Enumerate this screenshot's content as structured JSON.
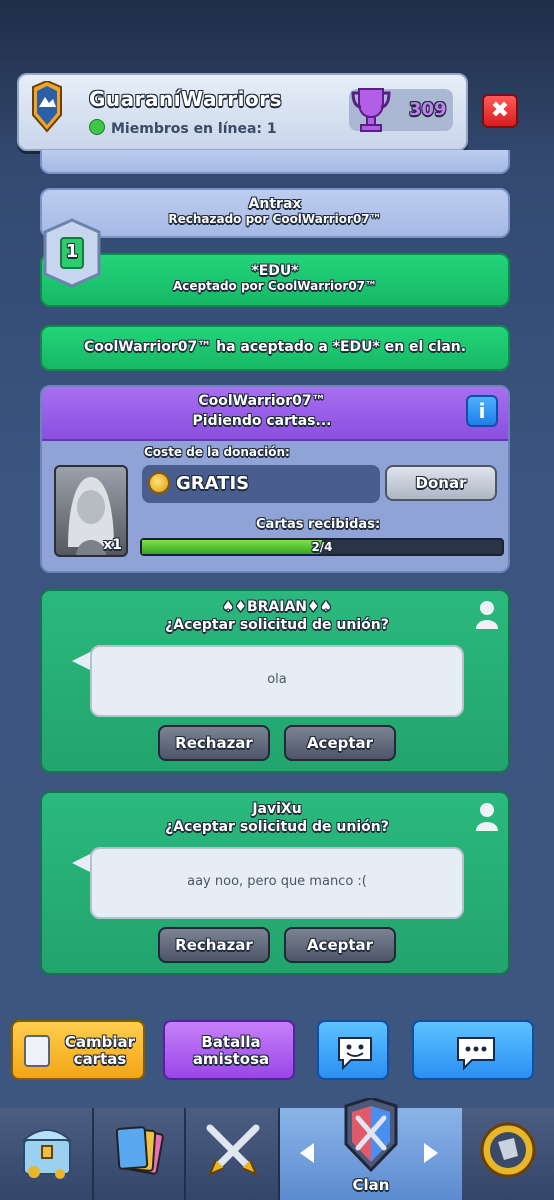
{
  "header": {
    "clan_name": "GuaraníWarriors",
    "online_text": "Miembros en línea: 1",
    "trophies": "309"
  },
  "notices": [
    {
      "title": "Antrax",
      "subtitle": "Rechazado por CoolWarrior07™"
    },
    {
      "title": "*EDU*",
      "subtitle": "Aceptado por CoolWarrior07™"
    },
    {
      "title": "CoolWarrior07™ ha aceptado a *EDU* en el clan."
    }
  ],
  "level_badge": "1",
  "card_request": {
    "name": "CoolWarrior07™",
    "status": "Pidiendo cartas...",
    "cost_label": "Coste de la donación:",
    "cost_value": "GRATIS",
    "donate_label": "Donar",
    "received_label": "Cartas recibidas:",
    "progress_text": "2/4",
    "progress_fraction": 0.5,
    "card_count": "x1"
  },
  "join_requests": [
    {
      "name": "♠♦BRAIAN♦♠",
      "question": "¿Aceptar solicitud de unión?",
      "message": "ola",
      "reject": "Rechazar",
      "accept": "Aceptar"
    },
    {
      "name": "JaviXu",
      "question": "¿Aceptar solicitud de unión?",
      "message": "aay noo, pero que manco :(",
      "reject": "Rechazar",
      "accept": "Aceptar"
    }
  ],
  "actions": {
    "swap_cards": "Cambiar cartas",
    "friendly_battle": "Batalla amistosa"
  },
  "nav": {
    "active_tab": "Clan"
  },
  "colors": {
    "green_notice": "#1fca72",
    "purple_header": "#9a5ae8",
    "accept_green": "#25ad73"
  }
}
